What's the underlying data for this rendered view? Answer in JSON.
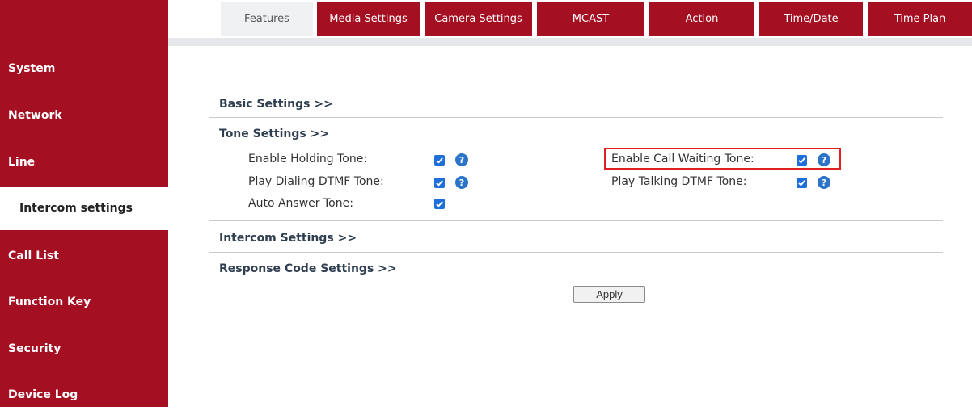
{
  "sidebar": {
    "items": [
      {
        "label": "System"
      },
      {
        "label": "Network"
      },
      {
        "label": "Line"
      },
      {
        "label": "Intercom settings",
        "active": true
      },
      {
        "label": "Call List"
      },
      {
        "label": "Function Key"
      },
      {
        "label": "Security"
      },
      {
        "label": "Device Log"
      }
    ]
  },
  "tabs": [
    {
      "label": "Features",
      "active": true
    },
    {
      "label": "Media Settings"
    },
    {
      "label": "Camera Settings"
    },
    {
      "label": "MCAST"
    },
    {
      "label": "Action"
    },
    {
      "label": "Time/Date"
    },
    {
      "label": "Time Plan"
    }
  ],
  "sections": {
    "basic": "Basic Settings >>",
    "tone": "Tone Settings >>",
    "intercom": "Intercom Settings >>",
    "response": "Response Code Settings >>"
  },
  "tone_settings": {
    "enable_holding_tone": {
      "label": "Enable Holding Tone:",
      "checked": true
    },
    "play_dialing_dtmf_tone": {
      "label": "Play Dialing DTMF Tone:",
      "checked": true
    },
    "auto_answer_tone": {
      "label": "Auto Answer Tone:",
      "checked": true
    },
    "enable_call_waiting_tone": {
      "label": "Enable Call Waiting Tone:",
      "checked": true
    },
    "play_talking_dtmf_tone": {
      "label": "Play Talking DTMF Tone:",
      "checked": true
    }
  },
  "help_glyph": "?",
  "apply_label": "Apply",
  "colors": {
    "brand_red": "#a50f22",
    "checkbox_blue": "#1e6fd9",
    "highlight_red": "#e02020"
  }
}
